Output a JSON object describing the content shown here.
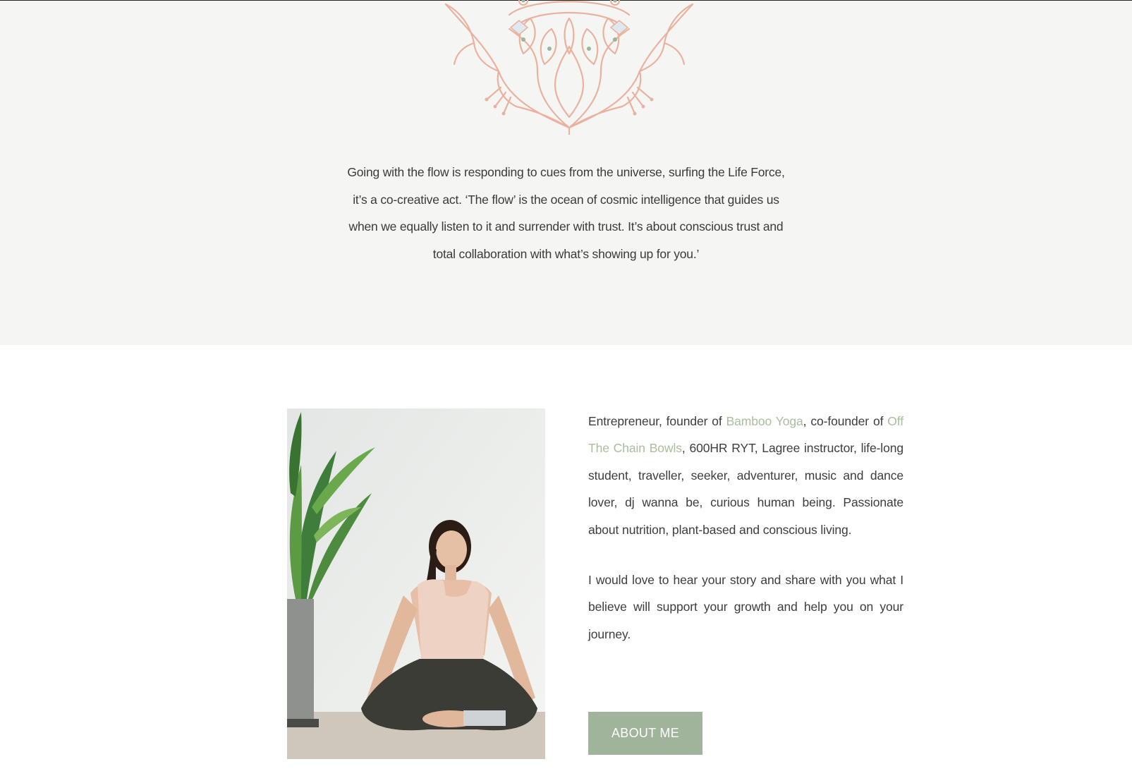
{
  "quote": {
    "lines": [
      "Going with the flow is responding to cues from the universe, surfing the Life Force,",
      "it’s a co-creative act. ‘The flow’ is the ocean of cosmic intelligence that guides us",
      "when we equally listen to it and surrender with trust. It’s about conscious trust and",
      "total collaboration with what’s showing up for you.’"
    ]
  },
  "bio": {
    "p1_pre": "Entrepreneur, founder of ",
    "link_bamboo": "Bamboo Yoga",
    "p1_mid": ", co-founder of ",
    "link_offchain": "Off The Chain Bowls",
    "p1_post": ", 600HR RYT, Lagree instructor, life-long student, traveller, seeker, adventurer, music and dance lover, dj wanna be, curious human being. Passionate about nutrition, plant-based and conscious living.",
    "p2": "I would love to hear your story and share with you what I believe will support your growth and help you on your journey."
  },
  "about_button": {
    "label": "ABOUT ME"
  },
  "icons": {
    "ornament": "mandala-icon"
  },
  "colors": {
    "accent": "#a9bd9f",
    "button": "#9fb49a",
    "mandala": "#eab29e",
    "mandala_dots": "#9bb59a",
    "band": "#f5f6f4"
  }
}
